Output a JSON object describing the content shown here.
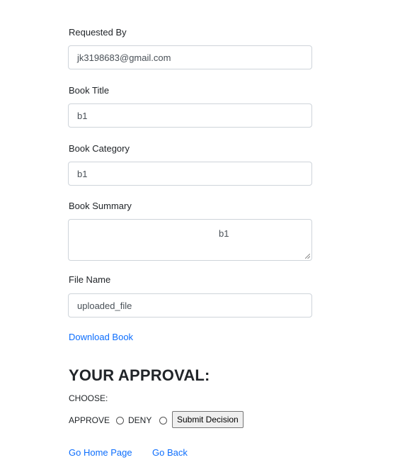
{
  "form": {
    "requested_by_label": "Requested By",
    "requested_by_value": "jk3198683@gmail.com",
    "book_title_label": "Book Title",
    "book_title_value": "b1",
    "book_category_label": "Book Category",
    "book_category_value": "b1",
    "book_summary_label": "Book Summary",
    "book_summary_value": "b1",
    "file_name_label": "File Name",
    "file_name_value": "uploaded_file",
    "download_link": "Download Book"
  },
  "approval": {
    "heading": "YOUR APPROVAL:",
    "choose_label": "CHOOSE:",
    "approve_label": "APPROVE",
    "deny_label": "DENY",
    "submit_label": "Submit Decision"
  },
  "nav": {
    "home_link": "Go Home Page",
    "back_link": "Go Back"
  },
  "colors": {
    "link": "#0d6efd",
    "border": "#ced4da"
  }
}
